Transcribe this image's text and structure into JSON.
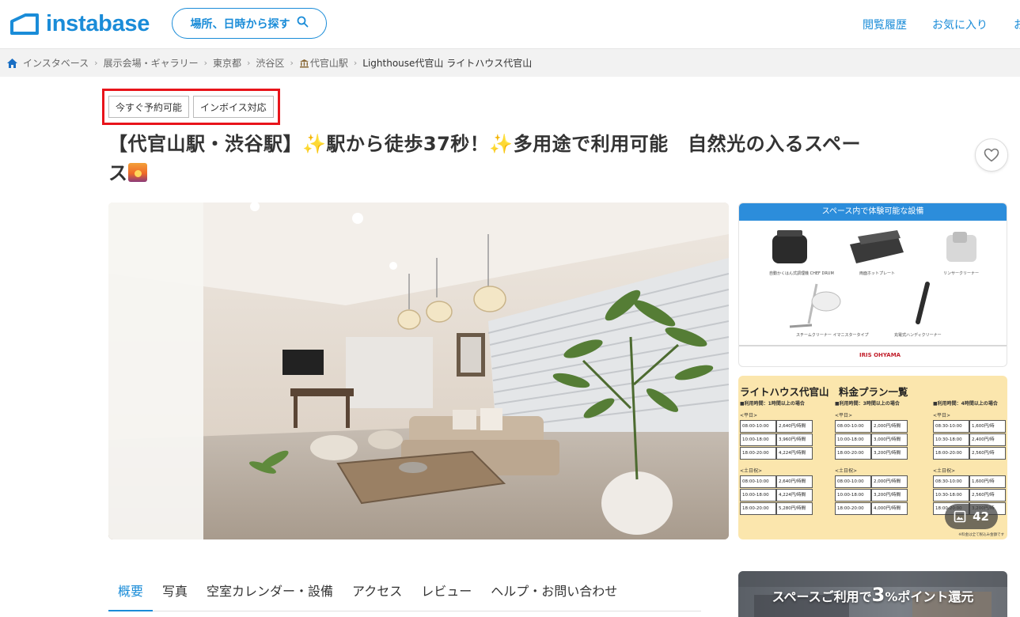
{
  "header": {
    "logo_text": "instabase",
    "search_label": "場所、日時から探す",
    "nav": [
      "閲覧履歴",
      "お気に入り",
      "お"
    ]
  },
  "breadcrumb": [
    "インスタベース",
    "展示会場・ギャラリー",
    "東京都",
    "渋谷区",
    "代官山駅",
    "Lighthouse代官山 ライトハウス代官山"
  ],
  "tags": [
    "今すぐ予約可能",
    "インボイス対応"
  ],
  "title": {
    "part1": "【代官山駅・渋谷駅】",
    "part2": "駅から徒歩37秒！",
    "part3": "多用途で利用可能　自然光の入るスペー",
    "part4": "ス"
  },
  "equipment_panel": {
    "heading": "スペース内で体験可能な設備",
    "items": [
      "自動かくはん式調理機 CHEF DRUM",
      "両面ホットプレート",
      "リンサークリーナー",
      "スチームクリーナー\nイマニスタータイプ",
      "充電式ハンディクリーナー"
    ],
    "brand": "IRIS OHYAMA"
  },
  "price_panel": {
    "title": "ライトハウス代官山　料金プラン一覧",
    "columns": [
      {
        "heading": "■利用時間：1時間以上の場合",
        "weekday_label": "<平日>",
        "weekday": [
          [
            "08:00-10:00",
            "2,640円/時間"
          ],
          [
            "10:00-18:00",
            "3,960円/時間"
          ],
          [
            "18:00-20:00",
            "4,224円/時間"
          ]
        ],
        "holiday_label": "<土日祝>",
        "holiday": [
          [
            "08:00-10:00",
            "2,640円/時間"
          ],
          [
            "10:00-18:00",
            "4,224円/時間"
          ],
          [
            "18:00-20:00",
            "5,280円/時間"
          ]
        ]
      },
      {
        "heading": "■利用時間：3時間以上の場合",
        "weekday_label": "<平日>",
        "weekday": [
          [
            "08:00-10:00",
            "2,000円/時間"
          ],
          [
            "10:00-18:00",
            "3,000円/時間"
          ],
          [
            "18:00-20:00",
            "3,200円/時間"
          ]
        ],
        "holiday_label": "<土日祝>",
        "holiday": [
          [
            "08:00-10:00",
            "2,000円/時間"
          ],
          [
            "10:00-18:00",
            "3,200円/時間"
          ],
          [
            "18:00-20:00",
            "4,000円/時間"
          ]
        ]
      },
      {
        "heading": "■利用時間：4時間以上の場合",
        "weekday_label": "<平日>",
        "weekday": [
          [
            "08:30-10:00",
            "1,600円/時"
          ],
          [
            "10:30-18:00",
            "2,400円/時"
          ],
          [
            "18:00-20:00",
            "2,560円/時"
          ]
        ],
        "holiday_label": "<土日祝>",
        "holiday": [
          [
            "08:30-10:00",
            "1,600円/時"
          ],
          [
            "10:30-18:00",
            "2,560円/時"
          ],
          [
            "18:00-20:00",
            "3,200円/時"
          ]
        ]
      }
    ],
    "footnote": "※料金は全て税込み金額です"
  },
  "photo_count": "42",
  "tabs": [
    "概要",
    "写真",
    "空室カレンダー・設備",
    "アクセス",
    "レビュー",
    "ヘルプ・お問い合わせ"
  ],
  "promo": {
    "prefix": "スペースご利用で",
    "big": "3",
    "suffix": "%ポイント還元"
  },
  "colors": {
    "brand": "#1a8cd8",
    "highlight_border": "#e8141b",
    "price_bg": "#fbe6ad"
  }
}
